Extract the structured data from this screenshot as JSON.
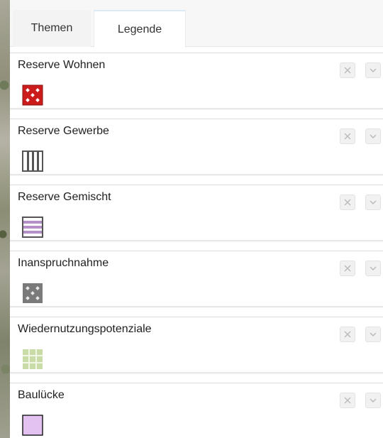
{
  "tabs": [
    {
      "label": "Themen",
      "active": false
    },
    {
      "label": "Legende",
      "active": true
    }
  ],
  "legend": {
    "items": [
      {
        "label": "Reserve Wohnen",
        "symbol": "red-diamond-pattern-swatch"
      },
      {
        "label": "Reserve Gewerbe",
        "symbol": "gray-vertical-stripes-swatch"
      },
      {
        "label": "Reserve Gemischt",
        "symbol": "violet-horizontal-stripes-swatch"
      },
      {
        "label": "Inanspruchnahme",
        "symbol": "gray-diamond-pattern-swatch"
      },
      {
        "label": "Wiedernutzungspotenziale",
        "symbol": "green-grid-swatch"
      },
      {
        "label": "Baulücke",
        "symbol": "lilac-filled-swatch"
      }
    ]
  },
  "icons": {
    "close": "close-icon",
    "expand": "chevron-down-icon"
  },
  "colors": {
    "reserve_wohnen": "#cc1b1b",
    "reserve_gewerbe": "#555555",
    "reserve_gemischt": "#b58fc9",
    "inanspruchnahme": "#7a7a7a",
    "wiedernutzungspotenziale": "#c9dba6",
    "bauluecke": "#e3c2f2"
  }
}
